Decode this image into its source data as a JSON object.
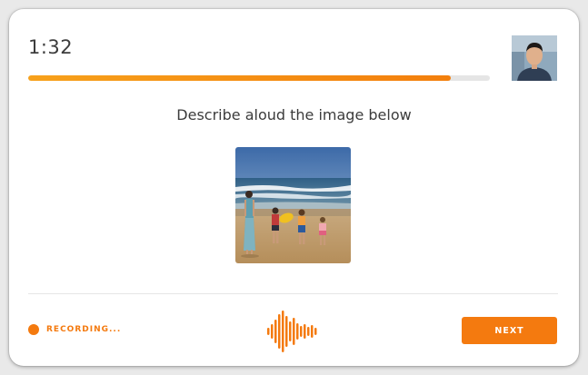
{
  "timer": {
    "time": "1:32"
  },
  "progress": {
    "fraction": 0.915
  },
  "prompt": {
    "text": "Describe aloud the image below"
  },
  "image": {
    "subject": "beach-family-photo"
  },
  "recording": {
    "label": "RECORDING..."
  },
  "waveform": {
    "icon": "audio-waveform-icon"
  },
  "actions": {
    "next_label": "NEXT"
  },
  "colors": {
    "accent": "#f47a0f",
    "progress_start": "#f7a11b",
    "progress_track": "#e5e5e5",
    "text": "#3c3c3c"
  }
}
